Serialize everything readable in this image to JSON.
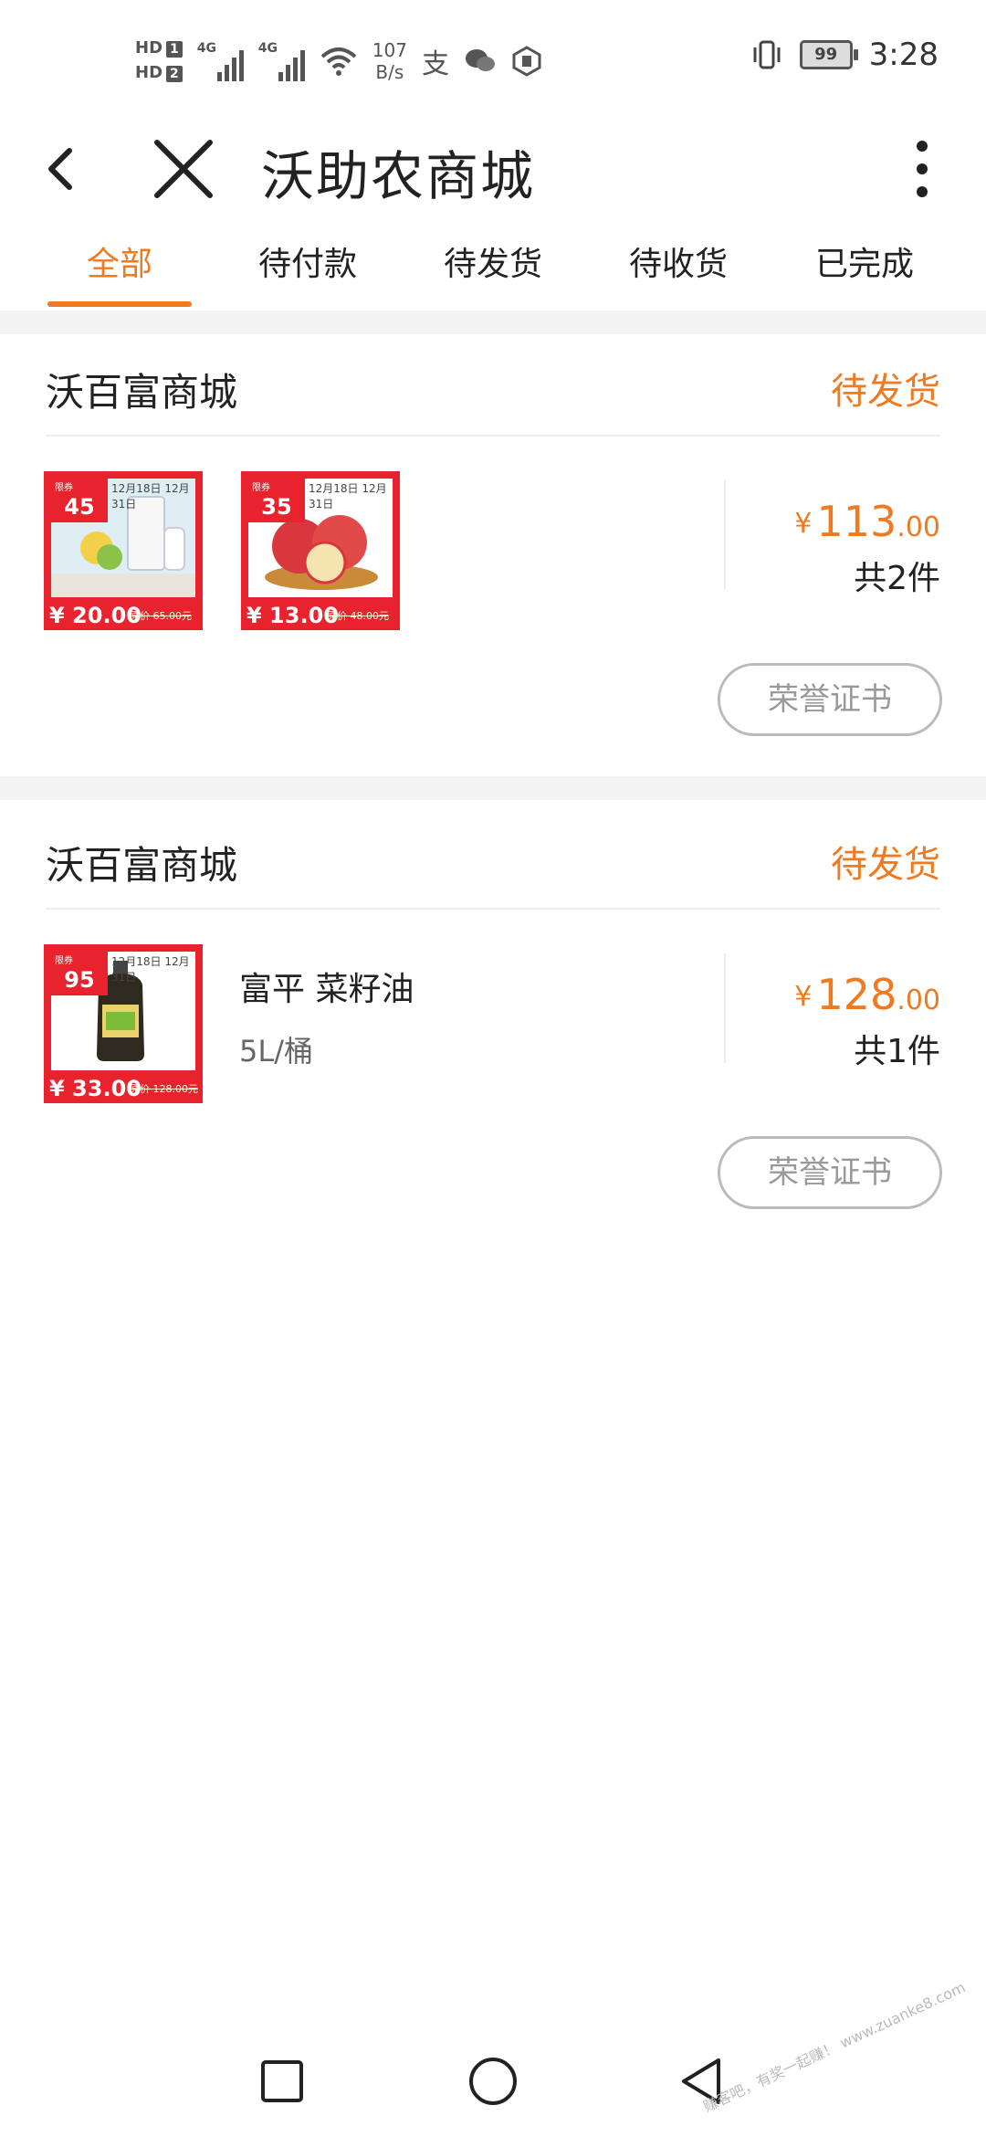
{
  "status_bar": {
    "hd1": "HD",
    "hd1_sim": "1",
    "hd2": "HD",
    "hd2_sim": "2",
    "net1": "4G",
    "net2": "4G",
    "speed_value": "107",
    "speed_unit": "B/s",
    "battery": "99",
    "time": "3:28",
    "icons": [
      "wifi-icon",
      "alipay-icon",
      "wechat-icon",
      "shield-icon",
      "vibrate-icon"
    ]
  },
  "header": {
    "title": "沃助农商城",
    "icons": [
      "back-icon",
      "close-icon",
      "more-icon"
    ]
  },
  "tabs": [
    {
      "label": "全部",
      "active": true
    },
    {
      "label": "待付款",
      "active": false
    },
    {
      "label": "待发货",
      "active": false
    },
    {
      "label": "待收货",
      "active": false
    },
    {
      "label": "已完成",
      "active": false
    }
  ],
  "orders": [
    {
      "store": "沃百富商城",
      "status": "待发货",
      "items": [
        {
          "tag": "45",
          "date": "12月18日  12月31日",
          "price": "¥ 20.00",
          "orig": "原价 65.00元",
          "type": "milk"
        },
        {
          "tag": "35",
          "date": "12月18日  12月31日",
          "price": "¥ 13.00",
          "orig": "原价 48.00元",
          "type": "apple"
        }
      ],
      "price_symbol": "¥",
      "price_int": "113",
      "price_dec": ".00",
      "quantity": "共2件",
      "button": "荣誉证书"
    },
    {
      "store": "沃百富商城",
      "status": "待发货",
      "items": [
        {
          "tag": "95",
          "date": "12月18日  12月31日",
          "price": "¥ 33.00",
          "orig": "原价 128.00元",
          "type": "oil"
        }
      ],
      "item_name": "富平 菜籽油",
      "item_spec": "5L/桶",
      "price_symbol": "¥",
      "price_int": "128",
      "price_dec": ".00",
      "quantity": "共1件",
      "button": "荣誉证书"
    }
  ],
  "colors": {
    "accent": "#ee7a21",
    "tag_red": "#e8232e",
    "divider": "#eeeeee"
  },
  "navbar": {
    "icons": [
      "recents-icon",
      "home-icon",
      "back-nav-icon"
    ]
  },
  "watermark": "赚客吧，有奖一起赚！ www.zuanke8.com"
}
